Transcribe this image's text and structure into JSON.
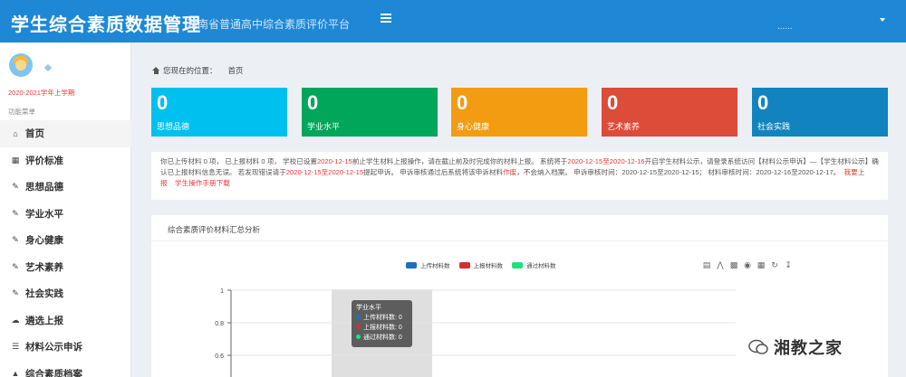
{
  "header": {
    "title": "学生综合素质数据管理",
    "subtitle": "湖南省普通高中综合素质评价平台",
    "user_text": "......"
  },
  "sidebar": {
    "term": "2020-2021学年上学期",
    "section_label": "功能菜单",
    "items": [
      {
        "label": "首页",
        "icon": "home-icon"
      },
      {
        "label": "评价标准",
        "icon": "map-icon"
      },
      {
        "label": "思想品德",
        "icon": "edit-icon"
      },
      {
        "label": "学业水平",
        "icon": "edit-icon"
      },
      {
        "label": "身心健康",
        "icon": "edit-icon"
      },
      {
        "label": "艺术素养",
        "icon": "edit-icon"
      },
      {
        "label": "社会实践",
        "icon": "edit-icon"
      },
      {
        "label": "遴选上报",
        "icon": "cloud-upload-icon"
      },
      {
        "label": "材料公示申诉",
        "icon": "list-icon"
      },
      {
        "label": "综合素质档案",
        "icon": "graduation-cap-icon"
      }
    ]
  },
  "breadcrumb": {
    "prefix": "您现在的位置：",
    "current": "首页"
  },
  "stats": [
    {
      "value": "0",
      "label": "思想品德",
      "color": "#00c0ef"
    },
    {
      "value": "0",
      "label": "学业水平",
      "color": "#00a65a"
    },
    {
      "value": "0",
      "label": "身心健康",
      "color": "#f39c12"
    },
    {
      "value": "0",
      "label": "艺术素养",
      "color": "#dd4b39"
    },
    {
      "value": "0",
      "label": "社会实践",
      "color": "#1184bf"
    }
  ],
  "notice": {
    "p1": "你已上传材料 0 项，  已上报材料 0 项，  学校已设置",
    "d1": "2020-12-15",
    "p2": "前止学生材料上报操作，请在截止前及时完成你的材料上报。  系统将于",
    "d2": "2020-12-15至2020-12-16",
    "p3": "开启学生材料公示，请登录系统访问【材料公示申诉】—【学生材料公示】确认已上报材料信息无误。  若发现错误请于",
    "d3": "2020-12-15至2020-12-15",
    "p4": "提起申诉。  申诉审核通过后系统将该申诉材料",
    "d4": "作废",
    "p5": "，不会纳入档案。  申诉审核时间：2020-12-15至2020-12-15；  材料审核时间：2020-12-16至2020-12-17。",
    "link1": "我要上报",
    "link2": "学生操作手册下载"
  },
  "chart_panel": {
    "title": "综合素质评价材料汇总分析"
  },
  "chart_data": {
    "type": "bar",
    "title": "",
    "categories": [
      "学业水平"
    ],
    "series": [
      {
        "name": "上传材料数",
        "values": [
          0
        ],
        "color": "#1e6fc2"
      },
      {
        "name": "上报材料数",
        "values": [
          0
        ],
        "color": "#d42e2e"
      },
      {
        "name": "通过材料数",
        "values": [
          0
        ],
        "color": "#22e07a"
      }
    ],
    "y_ticks": [
      "1",
      "0.8",
      "0.6"
    ],
    "ylim": [
      0,
      1
    ],
    "grid": true,
    "legend_position": "top"
  },
  "tooltip": {
    "title": "学业水平",
    "rows": [
      {
        "label": "上传材料数: 0",
        "color": "#1e6fc2"
      },
      {
        "label": "上报材料数: 0",
        "color": "#d42e2e"
      },
      {
        "label": "通过材料数: 0",
        "color": "#22e07a"
      }
    ]
  },
  "toolbox": [
    "data-view-icon",
    "line-chart-icon",
    "bar-chart-icon",
    "stack-icon",
    "tiled-icon",
    "refresh-icon",
    "download-icon"
  ],
  "watermark": {
    "text": "湘教之家"
  }
}
